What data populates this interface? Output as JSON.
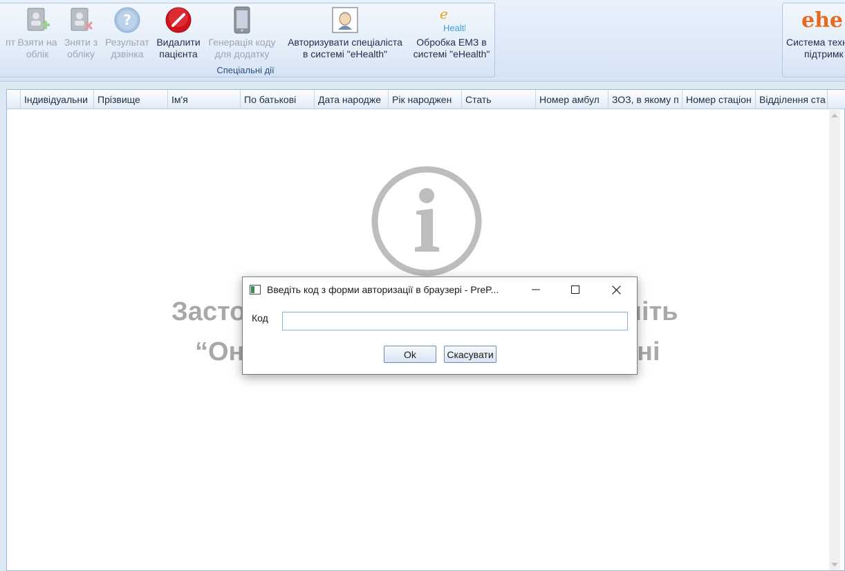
{
  "ribbon": {
    "left_cut_label": "пт",
    "buttons": [
      {
        "label_line1": "Взяти на",
        "label_line2": "облік",
        "icon": "register-patient-icon",
        "enabled": false
      },
      {
        "label_line1": "Зняти з",
        "label_line2": "обліку",
        "icon": "deregister-patient-icon",
        "enabled": false
      },
      {
        "label_line1": "Результат",
        "label_line2": "дзвінка",
        "icon": "question-icon",
        "enabled": false
      },
      {
        "label_line1": "Видалити",
        "label_line2": "пацієнта",
        "icon": "delete-icon",
        "enabled": true
      },
      {
        "label_line1": "Генерація коду",
        "label_line2": "для додатку",
        "icon": "phone-icon",
        "enabled": false
      },
      {
        "label_line1": "Авторизувати спеціаліста",
        "label_line2": "в системі \"eHealth\"",
        "icon": "specialist-icon",
        "enabled": true
      },
      {
        "label_line1": "Обробка ЕМЗ в",
        "label_line2": "системі \"eHealth\"",
        "icon": "ehealth-icon",
        "enabled": true
      }
    ],
    "group_title": "Спеціальні дії",
    "right_button": {
      "label_line1": "Система техн",
      "label_line2": "підтримк",
      "logo_text": "ehe"
    },
    "ehealth_icon_text": "Health"
  },
  "grid": {
    "columns": [
      "Індивідуальни",
      "Прізвище",
      "Ім'я",
      "По батькові",
      "Дата народже",
      "Рік народжен",
      "Стать",
      "Номер амбул",
      "ЗОЗ, в якому п",
      "Номер стаціон",
      "Відділення ста"
    ]
  },
  "placeholder": {
    "line1_left": "Засто",
    "line1_right": "ніть",
    "line2_left": "“Он",
    "line2_right": "ні"
  },
  "dialog": {
    "title": "Введіть код з форми авторизації в браузері - PreP...",
    "field_label": "Код",
    "field_value": "",
    "ok_label": "Ok",
    "cancel_label": "Скасувати"
  },
  "colors": {
    "delete_red": "#d0121b",
    "ehealth_orange": "#e96a1f",
    "disabled_text": "#9aa6b6",
    "group_title": "#2c4e7a"
  }
}
